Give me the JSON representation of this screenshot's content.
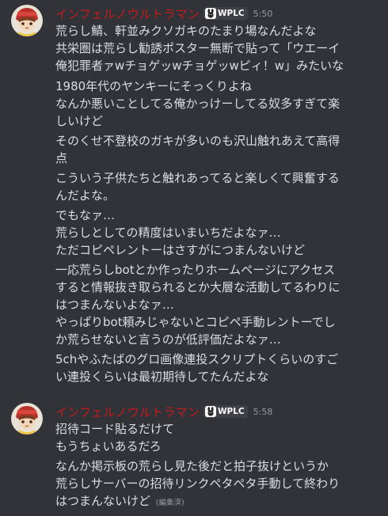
{
  "messages": [
    {
      "username": "インフェルノウルトラマン",
      "tag": "WPLC",
      "time": "5:50",
      "lines": [
        "荒らし鯖、軒並みクソガキのたまり場なんだよな",
        "共栄圏は荒らし勧誘ポスター無断で貼って「ウエーイ",
        "俺犯罪者ァwチョゲッwチョゲッwピィ！w」みたいな",
        "1980年代のヤンキーにそっくりよね",
        "なんか悪いことしてる俺かっけーしてる奴多すぎて楽",
        "しいけど",
        "そのくせ不登校のガキが多いのも沢山触れあえて高得",
        "点",
        "こういう子供たちと触れあってると楽しくて興奮する",
        "んだよな。",
        "でもなァ…",
        "荒らしとしての精度はいまいちだよなァ…",
        "ただコピペレントーはさすがにつまんないけど",
        "一応荒らしbotとか作ったりホームページにアクセス",
        "すると情報抜き取られるとか大層な活動してるわりに",
        "はつまんないよなァ…",
        "やっぱりbot頼みじゃないとコピペ手動レントーでし",
        "か荒らせないと言うのが低評価だよなァ…",
        "5chやふたばのグロ画像連投スクリプトくらいのすご",
        "い連投くらいは最初期待してたんだよな"
      ]
    },
    {
      "username": "インフェルノウルトラマン",
      "tag": "WPLC",
      "time": "5:58",
      "lines": [
        "招待コード貼るだけて",
        "もうちょいあるだろ",
        "なんか掲示板の荒らし見た後だと拍子抜けというか",
        "荒らしサーバーの招待リンクペタペタ手動して終わり",
        "はつまんないけど"
      ],
      "edited": "(編集済)"
    }
  ],
  "colors": {
    "background": "#313338",
    "username": "#c61a1a",
    "text": "#dbdee1",
    "muted": "#949ba4"
  },
  "icons": {
    "avatar": "avatar-character",
    "tag": "rabbit-icon"
  }
}
